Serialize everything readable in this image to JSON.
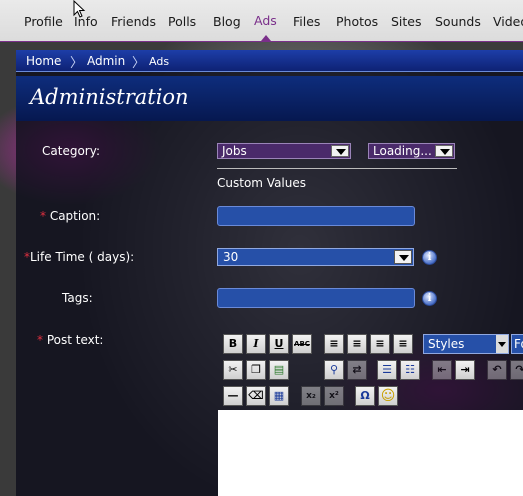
{
  "nav": {
    "tabs": [
      {
        "label": "Profile"
      },
      {
        "label": "Info"
      },
      {
        "label": "Friends"
      },
      {
        "label": "Polls"
      },
      {
        "label": "Blog"
      },
      {
        "label": "Ads",
        "active": true
      },
      {
        "label": "Files"
      },
      {
        "label": "Photos"
      },
      {
        "label": "Sites"
      },
      {
        "label": "Sounds"
      },
      {
        "label": "Video"
      }
    ]
  },
  "breadcrumb": {
    "items": [
      "Home",
      "Admin",
      "Ads"
    ],
    "separator": "〉"
  },
  "page_title": "Administration",
  "form": {
    "category_label": "Category:",
    "category_value": "Jobs",
    "subcategory_value": "Loading...",
    "custom_values_label": "Custom Values",
    "caption_label": "Caption:",
    "caption_value": "",
    "lifetime_label": "Life Time ( days):",
    "lifetime_value": "30",
    "tags_label": "Tags:",
    "tags_value": "",
    "posttext_label": "Post text:",
    "required_mark": "*"
  },
  "editor": {
    "styles_value": "Styles",
    "font_value": "Fo",
    "row1": [
      {
        "name": "bold-icon",
        "glyph": "B"
      },
      {
        "name": "italic-icon",
        "glyph": "I"
      },
      {
        "name": "underline-icon",
        "glyph": "U"
      },
      {
        "name": "strikethrough-icon",
        "glyph": "ABC"
      },
      {
        "name": "align-left-icon",
        "glyph": "≡"
      },
      {
        "name": "align-center-icon",
        "glyph": "≡"
      },
      {
        "name": "align-right-icon",
        "glyph": "≡"
      },
      {
        "name": "align-justify-icon",
        "glyph": "≡"
      }
    ],
    "row2": [
      {
        "name": "cut-icon",
        "glyph": "✂"
      },
      {
        "name": "copy-icon",
        "glyph": "❐"
      },
      {
        "name": "paste-icon",
        "glyph": "▤"
      },
      {
        "name": "find-icon",
        "glyph": "⚲"
      },
      {
        "name": "replace-icon",
        "glyph": "⇄"
      },
      {
        "name": "bullet-list-icon",
        "glyph": "☰"
      },
      {
        "name": "numbered-list-icon",
        "glyph": "☷"
      },
      {
        "name": "outdent-icon",
        "glyph": "⇤"
      },
      {
        "name": "indent-icon",
        "glyph": "⇥"
      },
      {
        "name": "undo-icon",
        "glyph": "↶"
      },
      {
        "name": "redo-icon",
        "glyph": "↷"
      }
    ],
    "row3": [
      {
        "name": "horizontal-rule-icon",
        "glyph": "—"
      },
      {
        "name": "eraser-icon",
        "glyph": "⌫"
      },
      {
        "name": "table-icon",
        "glyph": "▦"
      },
      {
        "name": "subscript-icon",
        "glyph": "x₂"
      },
      {
        "name": "superscript-icon",
        "glyph": "x²"
      },
      {
        "name": "char-map-icon",
        "glyph": "Ω"
      },
      {
        "name": "emoticon-icon",
        "glyph": "☺"
      }
    ]
  },
  "colors": {
    "accent": "#7a2f8a",
    "header_blue": "#0e2d7d",
    "field_blue": "#2650a8",
    "required": "#e03040"
  }
}
